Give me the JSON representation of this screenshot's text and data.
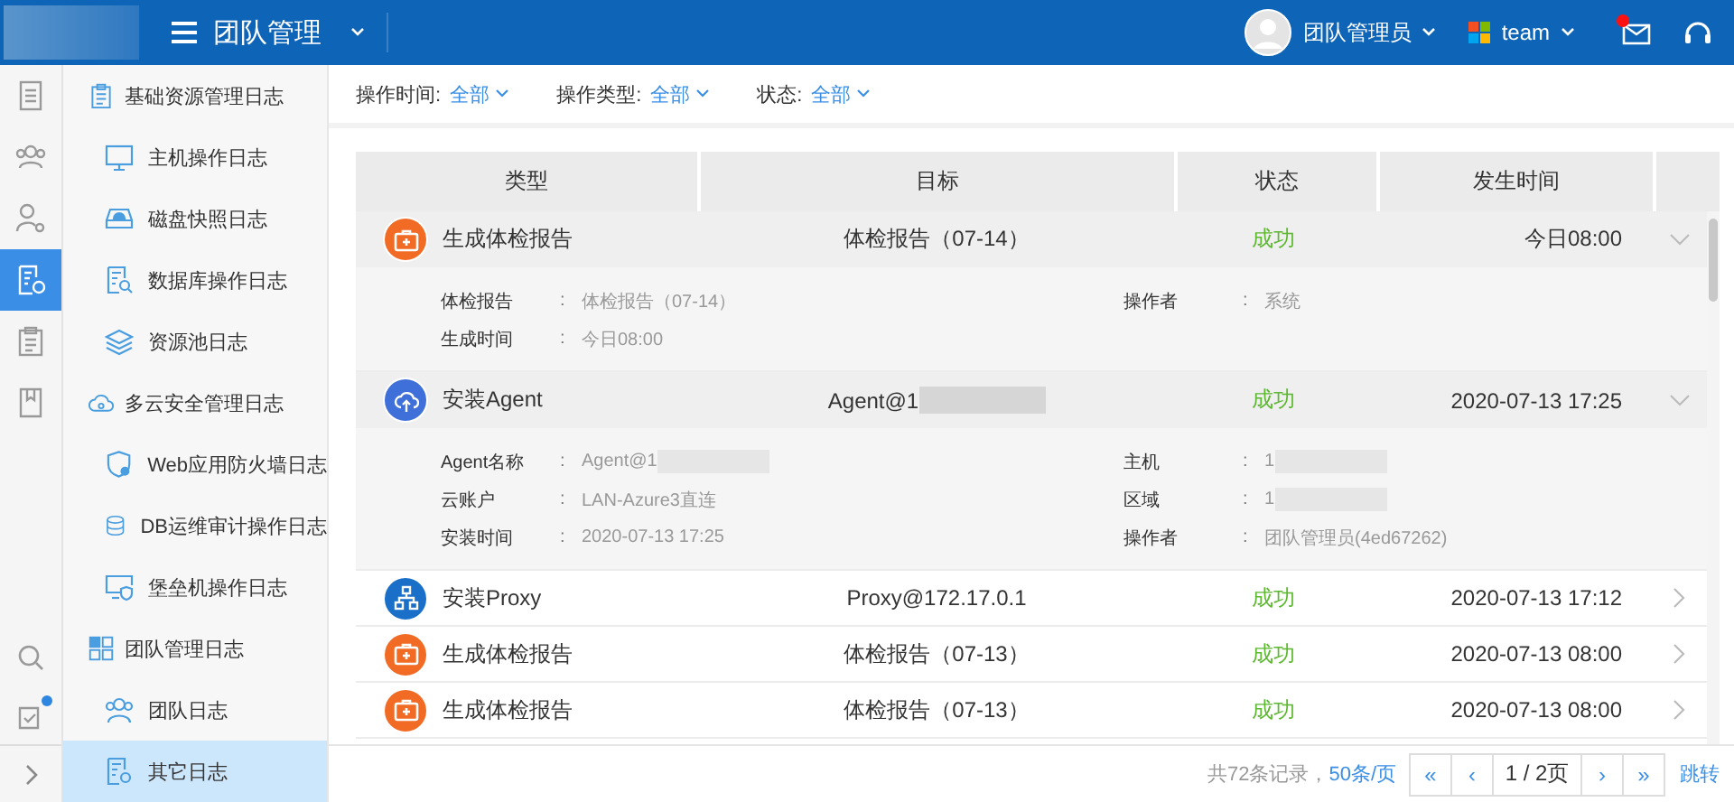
{
  "header": {
    "title": "团队管理",
    "user": "团队管理员",
    "team": "team",
    "mail_unread": true
  },
  "rail": {
    "items": [
      {
        "selected": false
      },
      {
        "selected": false
      },
      {
        "selected": false
      },
      {
        "selected": true
      },
      {
        "selected": false
      },
      {
        "selected": false
      }
    ],
    "tasks_badge": true
  },
  "sidebar": {
    "items": [
      {
        "kind": "group",
        "label": "基础资源管理日志",
        "selected": false
      },
      {
        "kind": "item",
        "label": "主机操作日志",
        "selected": false
      },
      {
        "kind": "item",
        "label": "磁盘快照日志",
        "selected": false
      },
      {
        "kind": "item",
        "label": "数据库操作日志",
        "selected": false
      },
      {
        "kind": "item",
        "label": "资源池日志",
        "selected": false
      },
      {
        "kind": "group",
        "label": "多云安全管理日志",
        "selected": false
      },
      {
        "kind": "item",
        "label": "Web应用防火墙日志",
        "selected": false
      },
      {
        "kind": "item",
        "label": "DB运维审计操作日志",
        "selected": false
      },
      {
        "kind": "item",
        "label": "堡垒机操作日志",
        "selected": false
      },
      {
        "kind": "group",
        "label": "团队管理日志",
        "selected": false
      },
      {
        "kind": "item",
        "label": "团队日志",
        "selected": false
      },
      {
        "kind": "item",
        "label": "其它日志",
        "selected": true
      }
    ]
  },
  "filters": [
    {
      "label": "操作时间:",
      "value": "全部"
    },
    {
      "label": "操作类型:",
      "value": "全部"
    },
    {
      "label": "状态:",
      "value": "全部"
    }
  ],
  "table": {
    "columns": [
      "类型",
      "目标",
      "状态",
      "发生时间"
    ],
    "rows": [
      {
        "kind": "report",
        "type": "生成体检报告",
        "target": "体检报告（07-14）",
        "target_redacted": false,
        "status": "成功",
        "time": "今日08:00",
        "expanded": true,
        "details_left": [
          {
            "label": "体检报告",
            "colon": ":",
            "value": "体检报告（07-14）",
            "redacted": false
          },
          {
            "label": "生成时间",
            "colon": ":",
            "value": "今日08:00",
            "redacted": false
          }
        ],
        "details_right": [
          {
            "label": "操作者",
            "colon": ":",
            "value": "系统",
            "redacted": false
          }
        ]
      },
      {
        "kind": "agent",
        "type": "安装Agent",
        "target": "Agent@1",
        "target_redacted": true,
        "status": "成功",
        "time": "2020-07-13 17:25",
        "expanded": true,
        "details_left": [
          {
            "label": "Agent名称",
            "colon": ":",
            "value": "Agent@1",
            "redacted": true
          },
          {
            "label": "云账户",
            "colon": ":",
            "value": "LAN-Azure3直连",
            "redacted": false
          },
          {
            "label": "安装时间",
            "colon": ":",
            "value": "2020-07-13 17:25",
            "redacted": false
          }
        ],
        "details_right": [
          {
            "label": "主机",
            "colon": ":",
            "value": "1",
            "redacted": true
          },
          {
            "label": "区域",
            "colon": ":",
            "value": "1",
            "redacted": true
          },
          {
            "label": "操作者",
            "colon": ":",
            "value": "团队管理员(4ed67262)",
            "redacted": false
          }
        ]
      },
      {
        "kind": "proxy",
        "type": "安装Proxy",
        "target": "Proxy@172.17.0.1",
        "target_redacted": false,
        "status": "成功",
        "time": "2020-07-13 17:12",
        "expanded": false
      },
      {
        "kind": "report",
        "type": "生成体检报告",
        "target": "体检报告（07-13）",
        "target_redacted": false,
        "status": "成功",
        "time": "2020-07-13 08:00",
        "expanded": false
      },
      {
        "kind": "report",
        "type": "生成体检报告",
        "target": "体检报告（07-13）",
        "target_redacted": false,
        "status": "成功",
        "time": "2020-07-13 08:00",
        "expanded": false
      }
    ]
  },
  "pagination": {
    "summary": "共72条记录，",
    "page_size": "50条/页",
    "first": "«",
    "prev": "‹",
    "page": "1 / 2页",
    "next": "›",
    "last": "»",
    "jump": "跳转"
  }
}
